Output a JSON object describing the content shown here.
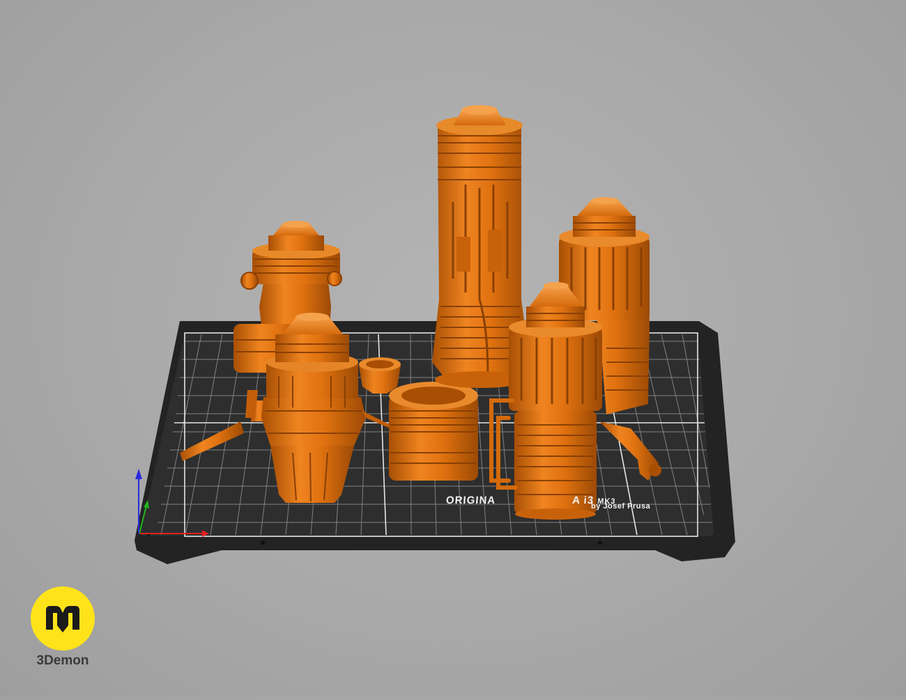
{
  "bed": {
    "label_line1_main": "ORIGINA",
    "label_line1_suffix": "A i3 ",
    "label_line1_small": "MK3",
    "label_line2": "by Josef Prusa"
  },
  "brand": {
    "name": "3Demon",
    "logo_letter": "m"
  },
  "colors": {
    "background": "#a9a9a9",
    "bed_surface": "#2b2b2b",
    "bed_grid": "#bdbdbd",
    "model_orange": "#e07210",
    "model_shadow": "#a44f06",
    "axis_x": "#e22020",
    "axis_y": "#22b522",
    "axis_z": "#2a2ae0",
    "brand_yellow": "#ffe31a"
  },
  "icons": [
    "axis-gizmo-icon",
    "brand-logo-icon"
  ]
}
